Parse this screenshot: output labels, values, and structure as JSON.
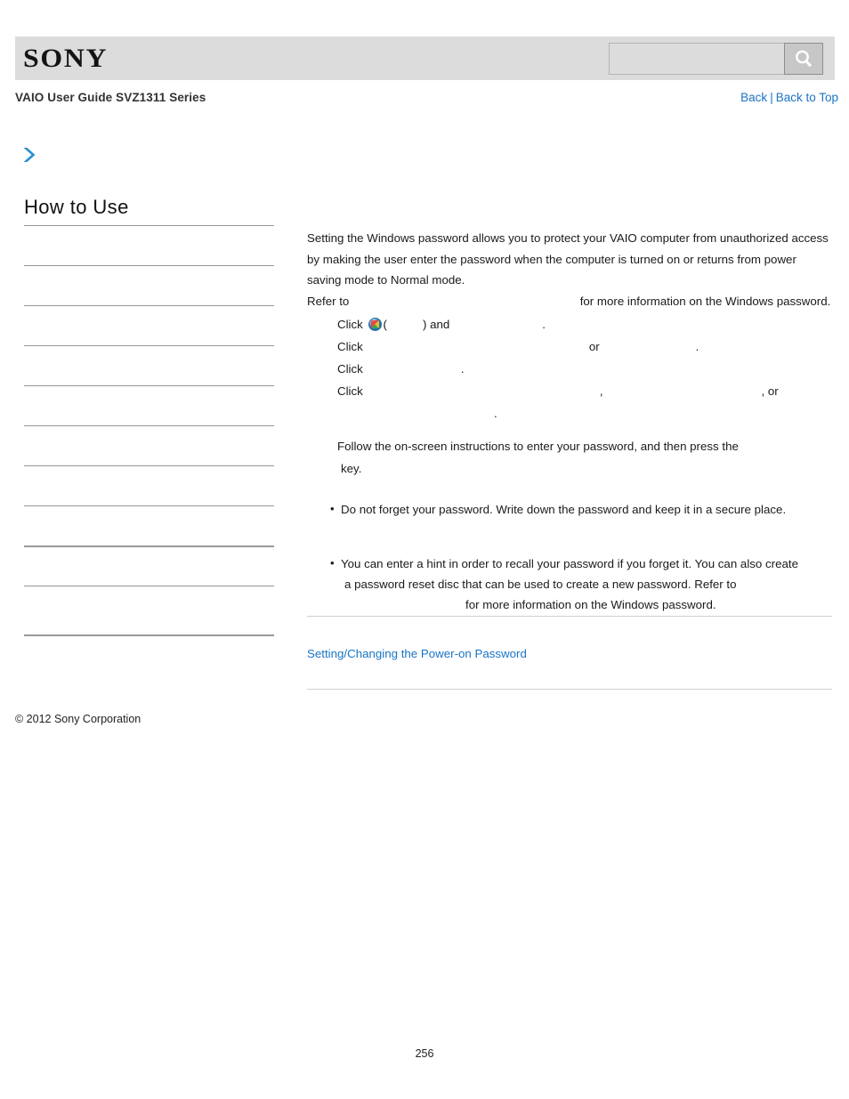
{
  "header": {
    "logo_text": "SONY",
    "search": {
      "value": "",
      "placeholder": "",
      "icon": "search-icon"
    }
  },
  "breadcrumb": {
    "doc_title": "VAIO User Guide SVZ1311 Series",
    "back_label": "Back",
    "separator": "|",
    "back_to_top_label": "Back to Top"
  },
  "sidebar": {
    "chevron_icon": "chevron-right-icon",
    "title": "How to Use",
    "items": [
      {
        "label": ""
      },
      {
        "label": ""
      },
      {
        "label": ""
      },
      {
        "label": ""
      },
      {
        "label": ""
      },
      {
        "label": ""
      },
      {
        "label": ""
      },
      {
        "label": ""
      },
      {
        "label": ""
      },
      {
        "label": ""
      },
      {
        "label": ""
      }
    ]
  },
  "main": {
    "intro": "Setting the Windows password allows you to protect your VAIO computer from unauthorized access by making the user enter the password when the computer is turned on or returns from power saving mode to Normal mode.",
    "refer_prefix": "Refer to",
    "refer_target": "",
    "refer_suffix": "for more information on the Windows password.",
    "steps": [
      {
        "prefix": "Click",
        "orb_icon": "windows-start-orb-icon",
        "open_paren": "(",
        "target_a": "",
        "close_paren": ")",
        "middle": "and",
        "target_b": "",
        "period": "."
      },
      {
        "prefix": "Click",
        "target_a": "",
        "conjunction": "or",
        "target_b": "",
        "period": "."
      },
      {
        "prefix": "Click",
        "target_a": "",
        "period": "."
      },
      {
        "prefix": "Click",
        "target_a": "",
        "comma_a": ",",
        "target_b": "",
        "comma_b": ", or",
        "target_c": "",
        "period": "."
      },
      {
        "text": "Follow the on-screen instructions to enter your password, and then press the",
        "key_name": "",
        "suffix": "key."
      }
    ],
    "notes": [
      {
        "text": "Do not forget your password. Write down the password and keep it in a secure place."
      },
      {
        "text_line1": "You can enter a hint in order to recall your password if you forget it. You can also create",
        "text_line2": "a password reset disc that can be used to create a new password. Refer to",
        "text_line3": "for more information on the Windows password."
      }
    ],
    "related_topic_link": "Setting/Changing the Power-on Password"
  },
  "footer": {
    "copyright": "© 2012 Sony Corporation",
    "page_number": "256"
  },
  "colors": {
    "link": "#1a74c4",
    "header_bg": "#dcdcdc",
    "divider": "#969696",
    "chevron": "#2a8fd0"
  }
}
